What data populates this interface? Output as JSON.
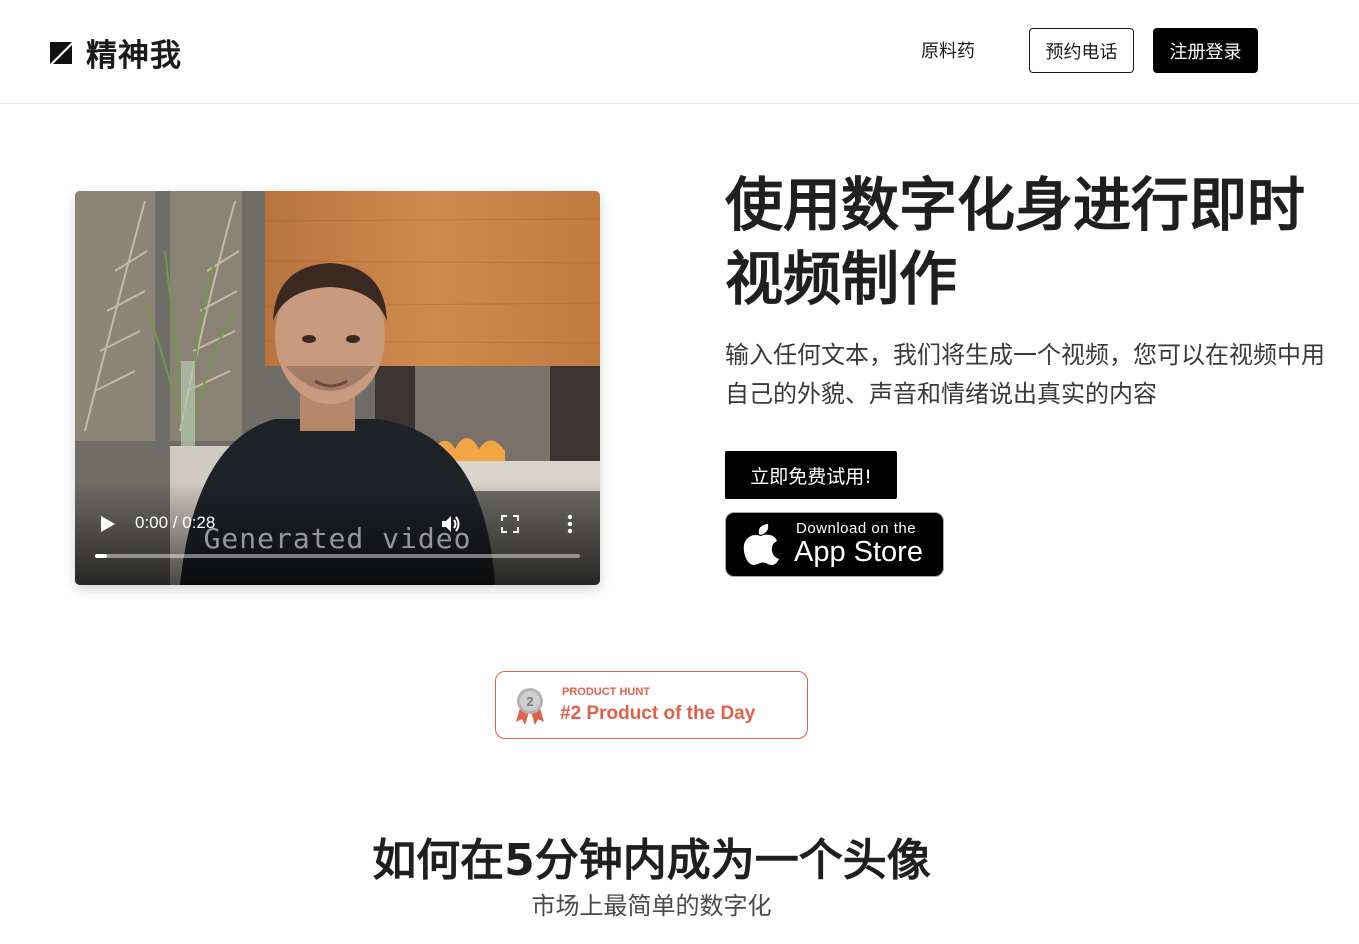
{
  "header": {
    "brand": "精神我",
    "nav_link": "原料药",
    "book_call": "预约电话",
    "signup": "注册登录"
  },
  "video": {
    "time": "0:00 / 0:28",
    "caption": "Generated video",
    "progress": 0.0
  },
  "hero": {
    "title": "使用数字化身进行即时视频制作",
    "subtitle": "输入任何文本，我们将生成一个视频，您可以在视频中用自己的外貌、声音和情绪说出真实的内容",
    "cta": "立即免费试用!",
    "appstore_small": "Download on the",
    "appstore_big": "App Store"
  },
  "badge": {
    "label_small": "PRODUCT HUNT",
    "label_big": "#2 Product of the Day",
    "rank": "2",
    "color": "#e0614a"
  },
  "section": {
    "title": "如何在5分钟内成为一个头像",
    "subtitle": "市场上最简单的数字化"
  }
}
